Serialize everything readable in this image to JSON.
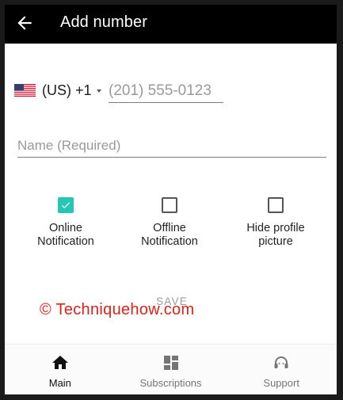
{
  "header": {
    "title": "Add number",
    "back_icon": "arrow-left-icon"
  },
  "phone": {
    "flag_icon": "us-flag-icon",
    "country_code": "(US) +1",
    "placeholder": "(201) 555-0123",
    "value": ""
  },
  "name": {
    "placeholder": "Name (Required)",
    "value": ""
  },
  "options": [
    {
      "label_line1": "Online",
      "label_line2": "Notification",
      "checked": true
    },
    {
      "label_line1": "Offline",
      "label_line2": "Notification",
      "checked": false
    },
    {
      "label_line1": "Hide profile",
      "label_line2": "picture",
      "checked": false
    }
  ],
  "save_label": "SAVE",
  "watermark": "© Techniquehow.com",
  "nav": {
    "items": [
      {
        "label": "Main",
        "icon": "home-icon",
        "active": true
      },
      {
        "label": "Subscriptions",
        "icon": "dashboard-icon",
        "active": false
      },
      {
        "label": "Support",
        "icon": "headset-icon",
        "active": false
      }
    ]
  },
  "colors": {
    "appbar": "#000000",
    "accent": "#26c6b5",
    "watermark": "#e0201a"
  }
}
